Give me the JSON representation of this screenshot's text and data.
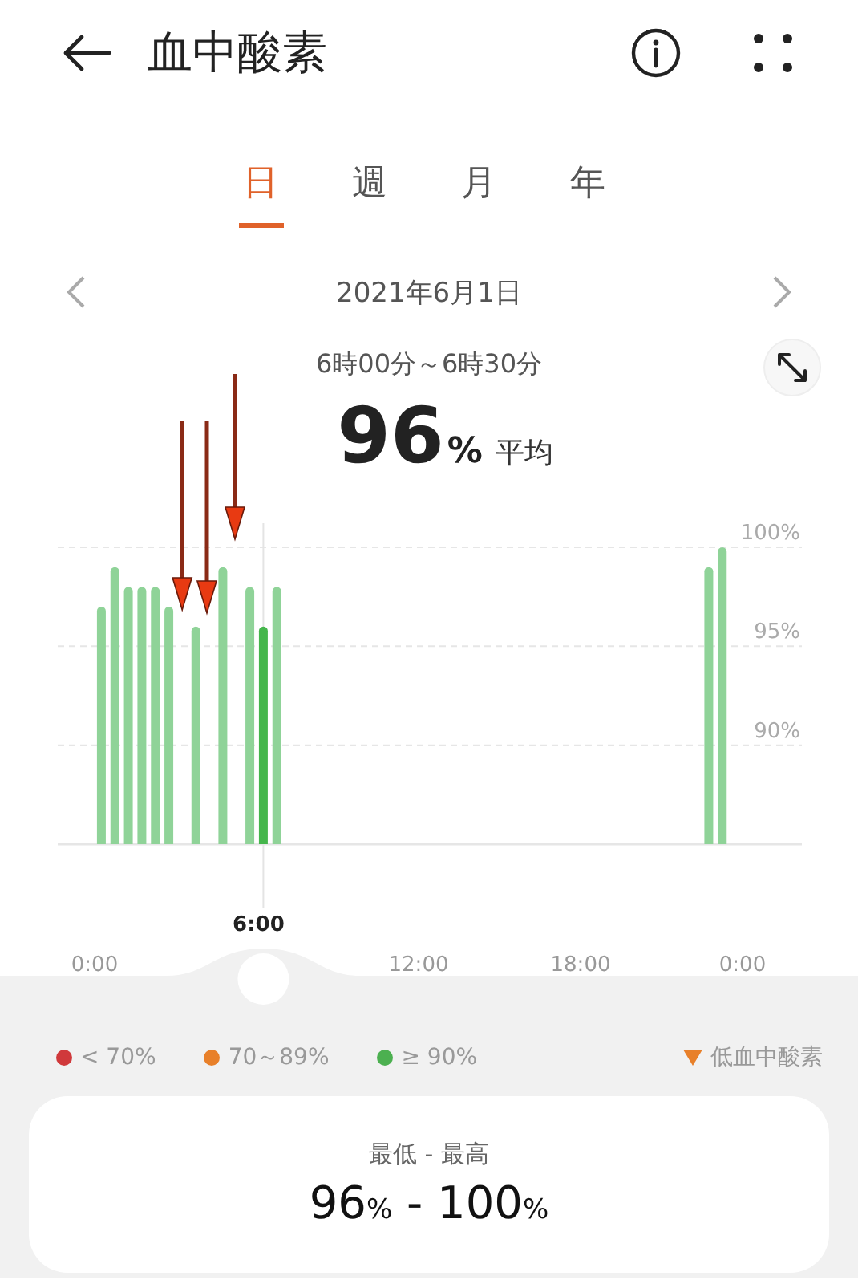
{
  "header": {
    "title": "血中酸素"
  },
  "tabs": [
    {
      "label": "日",
      "selected": true
    },
    {
      "label": "週",
      "selected": false
    },
    {
      "label": "月",
      "selected": false
    },
    {
      "label": "年",
      "selected": false
    }
  ],
  "date": "2021年6月1日",
  "time_range": "6時00分～6時30分",
  "average": {
    "value": "96",
    "unit": "%",
    "label": "平均"
  },
  "chart": {
    "selection": {
      "label": "6:00"
    },
    "markup_arrows": [
      {
        "kind": "arrow"
      },
      {
        "kind": "arrow"
      },
      {
        "kind": "arrow"
      }
    ],
    "chart_data": {
      "type": "bar",
      "x": [
        0.25,
        0.75,
        1.25,
        1.75,
        2.25,
        2.75,
        3.75,
        4.75,
        5.75,
        6.25,
        6.75,
        22.75,
        23.25
      ],
      "values": [
        97,
        99,
        98,
        98,
        98,
        97,
        96,
        99,
        98,
        96,
        98,
        99,
        100
      ],
      "xlim": [
        0,
        24
      ],
      "ylim": [
        85,
        100
      ],
      "xticks": [
        {
          "value": 0,
          "label": "0:00"
        },
        {
          "value": 12,
          "label": "12:00"
        },
        {
          "value": 18,
          "label": "18:00"
        },
        {
          "value": 24,
          "label": "0:00"
        }
      ],
      "yticks": [
        {
          "value": 100,
          "label": "100%"
        },
        {
          "value": 95,
          "label": "95%"
        },
        {
          "value": 90,
          "label": "90%"
        }
      ],
      "ref_lines": [
        {
          "axis": "x",
          "value": 6.25
        }
      ]
    }
  },
  "legend": [
    {
      "kind": "dot",
      "label": "< 70%",
      "color": "#d0393b"
    },
    {
      "kind": "dot",
      "label": "70～89%",
      "color": "#e8802a"
    },
    {
      "kind": "dot",
      "label": "≥ 90%",
      "color": "#4cb050"
    },
    {
      "kind": "triangle",
      "label": "低血中酸素",
      "color": "#e8802a"
    }
  ],
  "summary": {
    "label": "最低 - 最高",
    "min": {
      "value": "96",
      "unit": "%"
    },
    "separator": "-",
    "max": {
      "value": "100",
      "unit": "%"
    }
  }
}
